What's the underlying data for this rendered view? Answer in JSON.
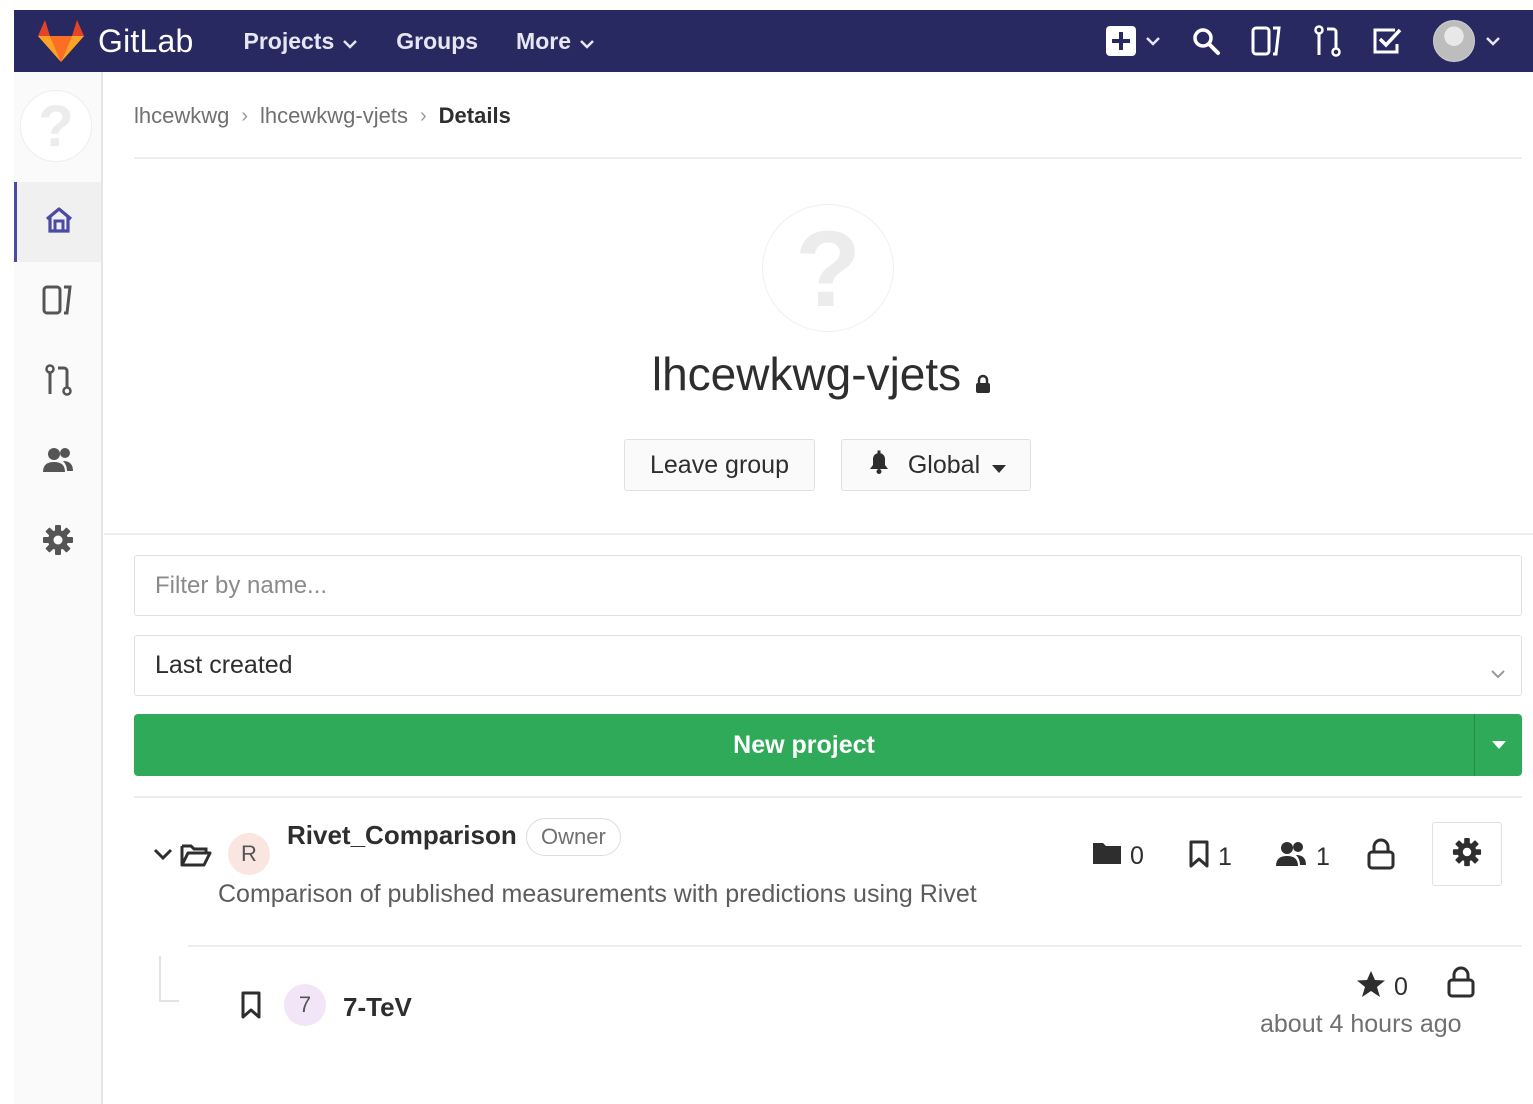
{
  "navbar": {
    "brand": "GitLab",
    "brand_icon": "gitlab-tanuki-icon",
    "links": [
      {
        "label": "Projects",
        "has_dropdown": true
      },
      {
        "label": "Groups",
        "has_dropdown": false
      },
      {
        "label": "More",
        "has_dropdown": true
      }
    ],
    "right_icons": [
      "plus-square-icon",
      "search-icon",
      "issues-icon",
      "merge-request-icon",
      "todo-check-icon",
      "user-avatar"
    ],
    "background": "#292961"
  },
  "sidebar": {
    "items": [
      {
        "icon": "home-icon",
        "active": true
      },
      {
        "icon": "issues-icon",
        "active": false
      },
      {
        "icon": "merge-request-icon",
        "active": false
      },
      {
        "icon": "members-icon",
        "active": false
      },
      {
        "icon": "settings-gear-icon",
        "active": false
      }
    ]
  },
  "breadcrumb": {
    "items": [
      "lhcewkwg",
      "lhcewkwg-vjets"
    ],
    "current": "Details"
  },
  "group": {
    "title": "lhcewkwg-vjets",
    "avatar_glyph": "?",
    "visibility_icon": "lock-icon",
    "leave_label": "Leave group",
    "notification_label": "Global"
  },
  "filters": {
    "search_placeholder": "Filter by name...",
    "sort_selected": "Last created"
  },
  "new_project": {
    "label": "New project",
    "color": "#2eaa58"
  },
  "projects": [
    {
      "name": "Rivet_Comparison",
      "avatar_letter": "R",
      "role": "Owner",
      "description": "Comparison of published measurements with predictions using Rivet",
      "subgroups": "0",
      "projects": "1",
      "members": "1",
      "children": [
        {
          "name": "7-TeV",
          "avatar_letter": "7",
          "stars": "0",
          "updated": "about 4 hours ago"
        }
      ]
    }
  ]
}
